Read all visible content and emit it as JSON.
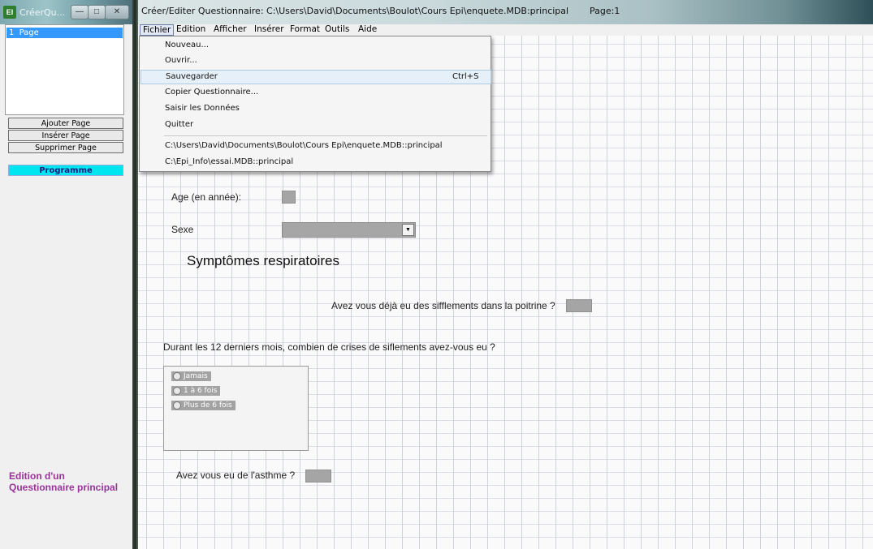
{
  "left_window": {
    "title": "CréerQu...",
    "app_icon_text": "EI",
    "pages_list": [
      {
        "number": "1",
        "label": "Page"
      }
    ],
    "buttons": {
      "add_page": "Ajouter Page",
      "insert_page": "Insérer Page",
      "delete_page": "Supprimer Page",
      "program": "Programme"
    },
    "status": "Edition d'un Questionnaire principal"
  },
  "main_window": {
    "title": "Créer/Editer Questionnaire: C:\\Users\\David\\Documents\\Boulot\\Cours Epi\\enquete.MDB:principal",
    "page_indicator": "Page:1"
  },
  "menubar": {
    "items": [
      "Fichier",
      "Edition",
      "Afficher",
      "Insérer",
      "Format",
      "Outils",
      "Aide"
    ]
  },
  "fichier_menu": {
    "items": [
      {
        "label": "Nouveau...",
        "shortcut": ""
      },
      {
        "label": "Ouvrir...",
        "shortcut": ""
      },
      {
        "label": "Sauvegarder",
        "shortcut": "Ctrl+S"
      },
      {
        "label": "Copier Questionnaire...",
        "shortcut": ""
      },
      {
        "label": "Saisir les Données",
        "shortcut": ""
      },
      {
        "label": "Quitter",
        "shortcut": ""
      }
    ],
    "recent": [
      "C:\\Users\\David\\Documents\\Boulot\\Cours Epi\\enquete.MDB::principal",
      "C:\\Epi_Info\\essai.MDB::principal"
    ]
  },
  "form": {
    "age_label": "Age (en année):",
    "sexe_label": "Sexe",
    "section_title": "Symptômes respiratoires",
    "wheeze_question": "Avez vous déjà eu des sifflements dans la poitrine ?",
    "crises_question": "Durant les 12 derniers mois, combien de crises de siflements avez-vous eu ?",
    "crises_options": [
      "Jamais",
      "1 à 6 fois",
      "Plus de 6 fois"
    ],
    "asthma_question": "Avez vous eu de l'asthme ?"
  },
  "colors": {
    "accent_blue": "#3399ff",
    "program_button": "#00e6f0",
    "status_text": "#993399",
    "field_grey": "#a5a5a5"
  }
}
